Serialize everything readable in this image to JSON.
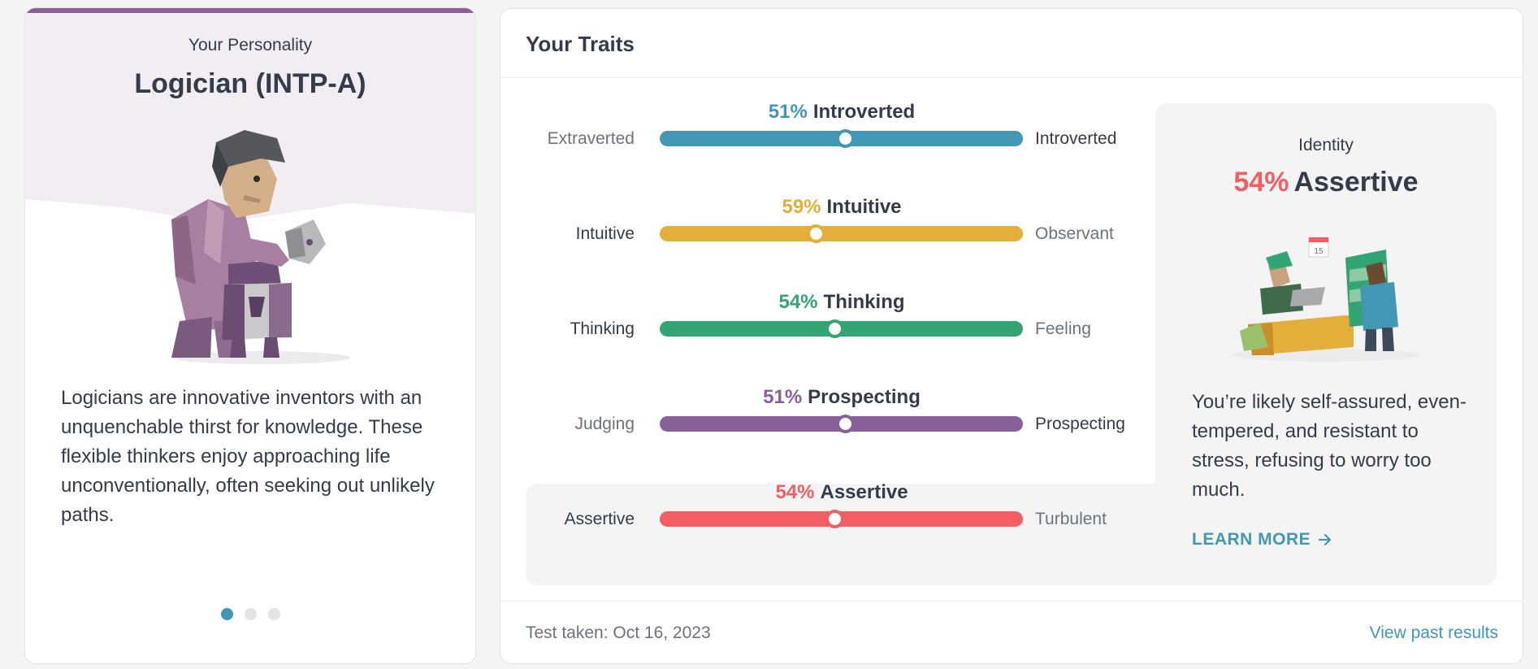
{
  "personality": {
    "label": "Your Personality",
    "title": "Logician (INTP-A)",
    "description": "Logicians are innovative inventors with an unquenchable thirst for knowledge. These flexible thinkers enjoy approaching life unconventionally, often seeking out unlikely paths.",
    "carousel_dots": 3,
    "active_dot": 0,
    "accent_color": "#88619a",
    "hero_bg_color": "#f1edf3"
  },
  "traits": {
    "header": "Your Traits",
    "items": [
      {
        "pct": "51%",
        "name": "Introverted",
        "left": "Extraverted",
        "right": "Introverted",
        "value": 51,
        "position": 0.51,
        "color": "#4298b4",
        "dominant": "right"
      },
      {
        "pct": "59%",
        "name": "Intuitive",
        "left": "Intuitive",
        "right": "Observant",
        "value": 59,
        "position": 0.43,
        "color": "#e4ae3a",
        "dominant": "left"
      },
      {
        "pct": "54%",
        "name": "Thinking",
        "left": "Thinking",
        "right": "Feeling",
        "value": 54,
        "position": 0.48,
        "color": "#33a474",
        "dominant": "left"
      },
      {
        "pct": "51%",
        "name": "Prospecting",
        "left": "Judging",
        "right": "Prospecting",
        "value": 51,
        "position": 0.51,
        "color": "#88619a",
        "dominant": "right"
      },
      {
        "pct": "54%",
        "name": "Assertive",
        "left": "Assertive",
        "right": "Turbulent",
        "value": 54,
        "position": 0.48,
        "color": "#f25e62",
        "dominant": "left"
      }
    ],
    "footer_date": "Test taken: Oct 16, 2023",
    "footer_link": "View past results"
  },
  "identity": {
    "label": "Identity",
    "pct": "54%",
    "name": "Assertive",
    "description": "You’re likely self-assured, even-tempered, and resistant to stress, refusing to worry too much.",
    "learn_more": "LEARN MORE",
    "calendar_day": "15"
  }
}
